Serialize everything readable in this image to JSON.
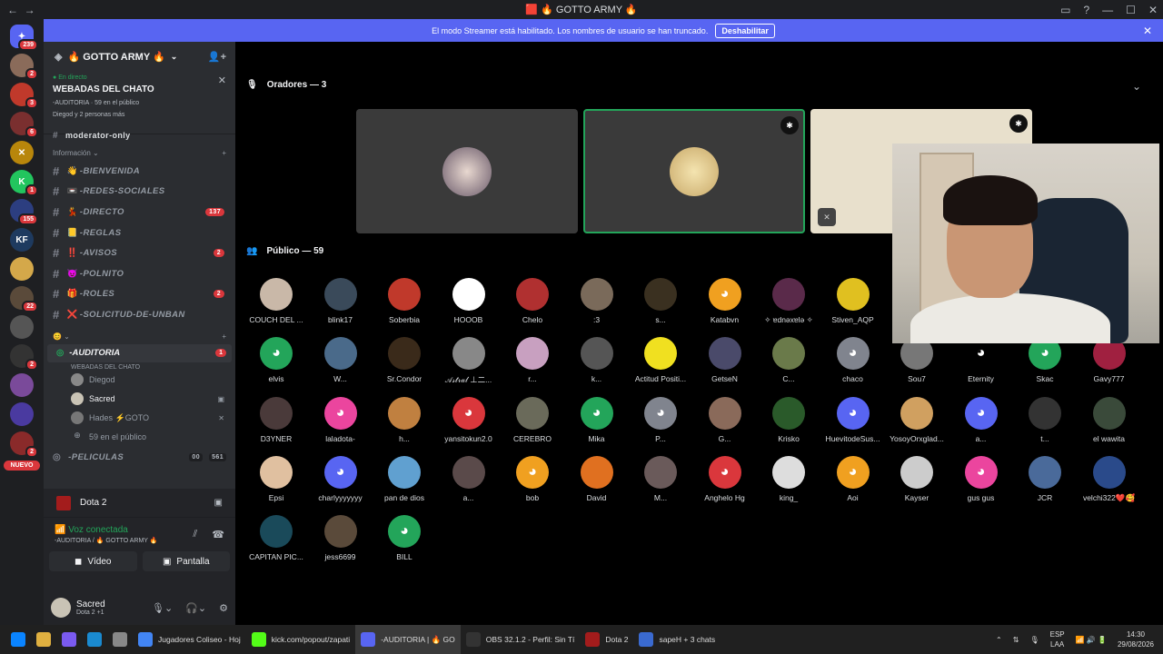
{
  "window": {
    "title": "🟥 🔥 GOTTO ARMY 🔥"
  },
  "banner": {
    "text": "El modo Streamer está habilitado. Los nombres de usuario se han truncado.",
    "button": "Deshabilitar"
  },
  "servers": [
    {
      "badge": "239",
      "color": "#5865f2",
      "glyph": "✦"
    },
    {
      "badge": "2",
      "color": "#8a6b5a",
      "glyph": ""
    },
    {
      "badge": "3",
      "color": "#c0392b",
      "glyph": ""
    },
    {
      "badge": "6",
      "color": "#7a2f2f",
      "glyph": ""
    },
    {
      "badge": "",
      "color": "#b8860b",
      "glyph": "✕"
    },
    {
      "badge": "1",
      "color": "#22c55e",
      "glyph": "K"
    },
    {
      "badge": "155",
      "color": "#2c3e80",
      "glyph": ""
    },
    {
      "badge": "",
      "color": "#1e3a5f",
      "glyph": "KF"
    },
    {
      "badge": "",
      "color": "#d4a84a",
      "glyph": ""
    },
    {
      "badge": "22",
      "color": "#5a4a3a",
      "glyph": ""
    },
    {
      "badge": "",
      "color": "#555",
      "glyph": ""
    },
    {
      "badge": "2",
      "color": "#333",
      "glyph": ""
    },
    {
      "badge": "",
      "color": "#7a4a9a",
      "glyph": ""
    },
    {
      "badge": "",
      "color": "#4a3aa0",
      "glyph": ""
    },
    {
      "badge": "2",
      "color": "#8a2a2a",
      "glyph": ""
    }
  ],
  "servers_new": "NUEVO",
  "sidebar": {
    "guild_name": "🔥 GOTTO ARMY 🔥",
    "live": {
      "tag": "En directo",
      "name": "WEBADAS DEL CHATO",
      "meta": "-AUDITORIA · 59 en el público",
      "meta2": "Diegod y 2 personas más"
    },
    "partial_channel": "moderator-only",
    "category": "Información",
    "channels": [
      {
        "emoji": "👋",
        "name": "-BIENVENIDA",
        "badge": ""
      },
      {
        "emoji": "📼",
        "name": "-REDES-SOCIALES",
        "badge": ""
      },
      {
        "emoji": "💃",
        "name": "-DIRECTO",
        "badge": "137"
      },
      {
        "emoji": "📒",
        "name": "-REGLAS",
        "badge": ""
      },
      {
        "emoji": "‼️",
        "name": "-AVISOS",
        "badge": "2"
      },
      {
        "emoji": "😈",
        "name": "-POLNITO",
        "badge": ""
      },
      {
        "emoji": "🎁",
        "name": "-ROLES",
        "badge": "2"
      },
      {
        "emoji": "❌",
        "name": "-SOLICITUD-DE-UNBAN",
        "badge": ""
      }
    ],
    "category2": "😊 ⌄",
    "stage": {
      "name": "-AUDITORIA",
      "badge": "1",
      "sub": "WEBADAS DEL CHATO"
    },
    "stage_users": [
      {
        "name": "Diegod",
        "active": false,
        "icon": "",
        "color": "#888"
      },
      {
        "name": "Sacred",
        "active": true,
        "icon": "▣",
        "color": "#c9c3b5"
      },
      {
        "name": "Hades ⚡GOTO",
        "active": false,
        "icon": "✕",
        "color": "#777"
      }
    ],
    "audience_count": "59 en el público",
    "next_channel": "-PELICULAS",
    "next_channel_count": "561",
    "next_channel_users": "00"
  },
  "userpanel": {
    "game": "Dota 2",
    "voice_status": "Voz conectada",
    "voice_sub": "-AUDITORIA / 🔥 GOTTO ARMY 🔥",
    "video_label": "Vídeo",
    "screen_label": "Pantalla",
    "user_name": "Sacred",
    "user_activity": "Dota 2 +1"
  },
  "stage": {
    "speakers_label": "Oradores — 3",
    "audience_label": "Público — 59"
  },
  "audience": [
    {
      "n": "COUCH DEL ...",
      "c": "#c9b8a8"
    },
    {
      "n": "blink17",
      "c": "#3a4a5a"
    },
    {
      "n": "Soberbia",
      "c": "#c0392b"
    },
    {
      "n": "HOOOB",
      "c": "#ffffff"
    },
    {
      "n": "Chelo",
      "c": "#b03030"
    },
    {
      "n": ":3",
      "c": "#7a6a5a"
    },
    {
      "n": "s...",
      "c": "#3a3020"
    },
    {
      "n": "Katabvn",
      "c": "#f0a020",
      "d": true
    },
    {
      "n": "✧ ɐdnǝxɐlǝ ✧",
      "c": "#5a2a4a"
    },
    {
      "n": "Stiven_AQP",
      "c": "#e0c020"
    },
    {
      "n": "",
      "c": "transparent"
    },
    {
      "n": "",
      "c": "transparent"
    },
    {
      "n": "",
      "c": "transparent"
    },
    {
      "n": "",
      "c": "transparent"
    },
    {
      "n": "elvis",
      "c": "#23a55a",
      "d": true
    },
    {
      "n": "W...",
      "c": "#4a6a8a"
    },
    {
      "n": "Sr.Condor",
      "c": "#3a2a1a"
    },
    {
      "n": "𝒜𝓈𝓉𝓇𝒶𝓁 ⊥二...",
      "c": "#888"
    },
    {
      "n": "r...",
      "c": "#c8a0c0"
    },
    {
      "n": "k...",
      "c": "#555"
    },
    {
      "n": "Actitud Positi...",
      "c": "#f0e020"
    },
    {
      "n": "GetseN",
      "c": "#4a4a6a"
    },
    {
      "n": "C...",
      "c": "#6a7a4a"
    },
    {
      "n": "chaco",
      "c": "#80848e",
      "d": true
    },
    {
      "n": "Sou7",
      "c": "#777"
    },
    {
      "n": "Eternity",
      "c": "#000000",
      "d": true
    },
    {
      "n": "Skac",
      "c": "#23a55a",
      "d": true
    },
    {
      "n": "Gavy777",
      "c": "#a02040"
    },
    {
      "n": "D3YNER",
      "c": "#4a3a3a"
    },
    {
      "n": "laladota-",
      "c": "#eb459e",
      "d": true
    },
    {
      "n": "h...",
      "c": "#c08040"
    },
    {
      "n": "yansitokun2.0",
      "c": "#da373c",
      "d": true
    },
    {
      "n": "CEREBRO",
      "c": "#6a6a5a"
    },
    {
      "n": "Mika",
      "c": "#23a55a",
      "d": true
    },
    {
      "n": "P...",
      "c": "#80848e",
      "d": true
    },
    {
      "n": "G...",
      "c": "#8a6a5a"
    },
    {
      "n": "Krisko",
      "c": "#2a5a2a"
    },
    {
      "n": "HuevitodeSus...",
      "c": "#5865f2",
      "d": true
    },
    {
      "n": "YosoyOrxglad...",
      "c": "#d0a060"
    },
    {
      "n": "a...",
      "c": "#5865f2",
      "d": true
    },
    {
      "n": "t...",
      "c": "#333"
    },
    {
      "n": "el wawita",
      "c": "#3a4a3a"
    },
    {
      "n": "Epsi",
      "c": "#e0c0a0"
    },
    {
      "n": "charlyyyyyyy",
      "c": "#5865f2",
      "d": true
    },
    {
      "n": "pan de dios",
      "c": "#60a0d0"
    },
    {
      "n": "a...",
      "c": "#5a4a4a"
    },
    {
      "n": "bob",
      "c": "#f0a020",
      "d": true
    },
    {
      "n": "David",
      "c": "#e07020"
    },
    {
      "n": "M...",
      "c": "#6a5a5a"
    },
    {
      "n": "Anghelo Hg",
      "c": "#da373c",
      "d": true
    },
    {
      "n": "king_",
      "c": "#ddd"
    },
    {
      "n": "Aoi",
      "c": "#f0a020",
      "d": true
    },
    {
      "n": "Kayser",
      "c": "#ccc"
    },
    {
      "n": "gus gus",
      "c": "#eb459e",
      "d": true
    },
    {
      "n": "JCR",
      "c": "#4a6a9a"
    },
    {
      "n": "velchi322❤️🥰",
      "c": "#2a4a8a"
    },
    {
      "n": "CAPITAN PIC...",
      "c": "#1a4a5a"
    },
    {
      "n": "jess6699",
      "c": "#5a4a3a"
    },
    {
      "n": "BILL",
      "c": "#23a55a",
      "d": true
    }
  ],
  "taskbar": [
    {
      "label": "",
      "color": "#0a84ff"
    },
    {
      "label": "",
      "color": "#e0b040"
    },
    {
      "label": "",
      "color": "#7a5af0"
    },
    {
      "label": "",
      "color": "#1a8ad0"
    },
    {
      "label": "",
      "color": "#888"
    },
    {
      "label": "Jugadores Coliseo - Hoj",
      "color": "#4285f4"
    },
    {
      "label": "kick.com/popout/zapati",
      "color": "#53fc18"
    },
    {
      "label": "-AUDITORIA | 🔥 GO",
      "color": "#5865f2"
    },
    {
      "label": "OBS 32.1.2 - Perfil: Sin Tí",
      "color": "#333"
    },
    {
      "label": "Dota 2",
      "color": "#a31c1c"
    },
    {
      "label": "sapeH + 3 chats",
      "color": "#3a6ad0"
    }
  ],
  "tray": {
    "lang": "ESP\nLAA",
    "time": "14:30",
    "date": "29/08/2026"
  }
}
